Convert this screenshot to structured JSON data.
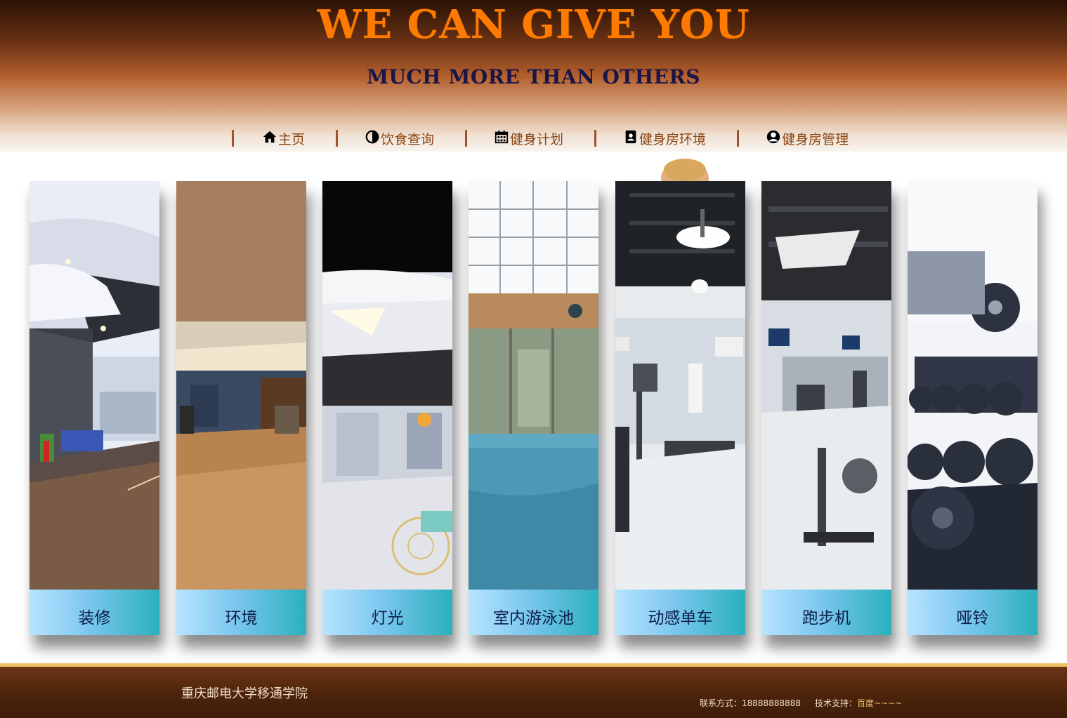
{
  "header": {
    "title": "WE CAN GIVE YOU",
    "subtitle": "MUCH MORE THAN OTHERS"
  },
  "nav": {
    "items": [
      {
        "label": "主页",
        "icon": "home-icon"
      },
      {
        "label": "饮食查询",
        "icon": "half-circle-icon"
      },
      {
        "label": "健身计划",
        "icon": "calendar-icon"
      },
      {
        "label": "健身房环境",
        "icon": "contact-book-icon"
      },
      {
        "label": "健身房管理",
        "icon": "user-circle-icon"
      }
    ]
  },
  "cards": [
    {
      "label": "装修"
    },
    {
      "label": "环境"
    },
    {
      "label": "灯光"
    },
    {
      "label": "室内游泳池"
    },
    {
      "label": "动感单车"
    },
    {
      "label": "跑步机"
    },
    {
      "label": "哑铃"
    }
  ],
  "footer": {
    "school": "重庆邮电大学移通学院",
    "contact_label": "联系方式：",
    "contact_value": "18888888888",
    "support_label": "技术支持：",
    "support_value": "百度~~~~"
  },
  "colors": {
    "title": "#ff7a00",
    "subtitle": "#1a1546",
    "nav_text": "#8b4513",
    "card_label_text": "#0d1e4a",
    "footer_bg": "#4a230b",
    "footer_accent": "#f0c060"
  }
}
